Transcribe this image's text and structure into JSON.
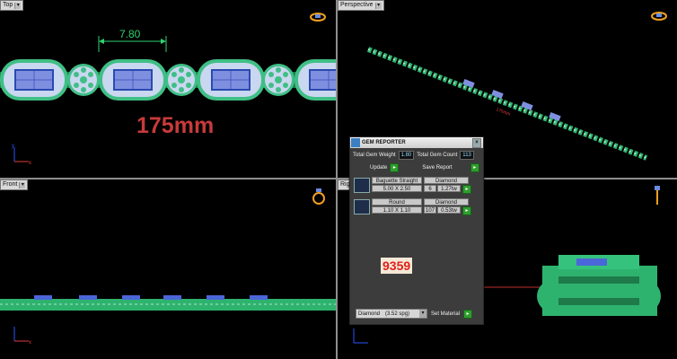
{
  "viewports": {
    "top": {
      "label": "Top"
    },
    "perspective": {
      "label": "Perspective"
    },
    "front": {
      "label": "Front"
    },
    "right": {
      "label": "Rig"
    }
  },
  "top_view": {
    "dimension": "7.80",
    "length_label": "175mm"
  },
  "perspective_view": {
    "length_label": "175mm"
  },
  "gem_reporter": {
    "title": "GEM REPORTER",
    "total_weight_label": "Total Gem Weight",
    "total_weight": "1.80",
    "total_count_label": "Total Gem Count",
    "total_count": "113",
    "update_label": "Update",
    "save_report_label": "Save Report",
    "gems": [
      {
        "shape": "Baguette Straight",
        "material": "Diamond",
        "size": "5.00 X 2.50",
        "count": "6",
        "weight": "1.27tw"
      },
      {
        "shape": "Round",
        "material": "Diamond",
        "size": "1.10 X 1.10",
        "count": "107",
        "weight": "0.53tw"
      }
    ],
    "price": "9359",
    "material_select": "Diamond",
    "material_sg": "(3.52 spg)",
    "set_material_label": "Set Material"
  },
  "colors": {
    "gem_green": "#2eb36f",
    "metal_dark": "#1f7a4a",
    "stone_blue": "#7f8fe0",
    "stone_light": "#c9d7f0",
    "dimension": "#2fd26f",
    "length_red": "#c83a3a",
    "price_red": "#e0201c"
  },
  "icons": [
    "ring-icon",
    "axis-icon",
    "close-icon",
    "gem-reporter-logo-icon"
  ]
}
